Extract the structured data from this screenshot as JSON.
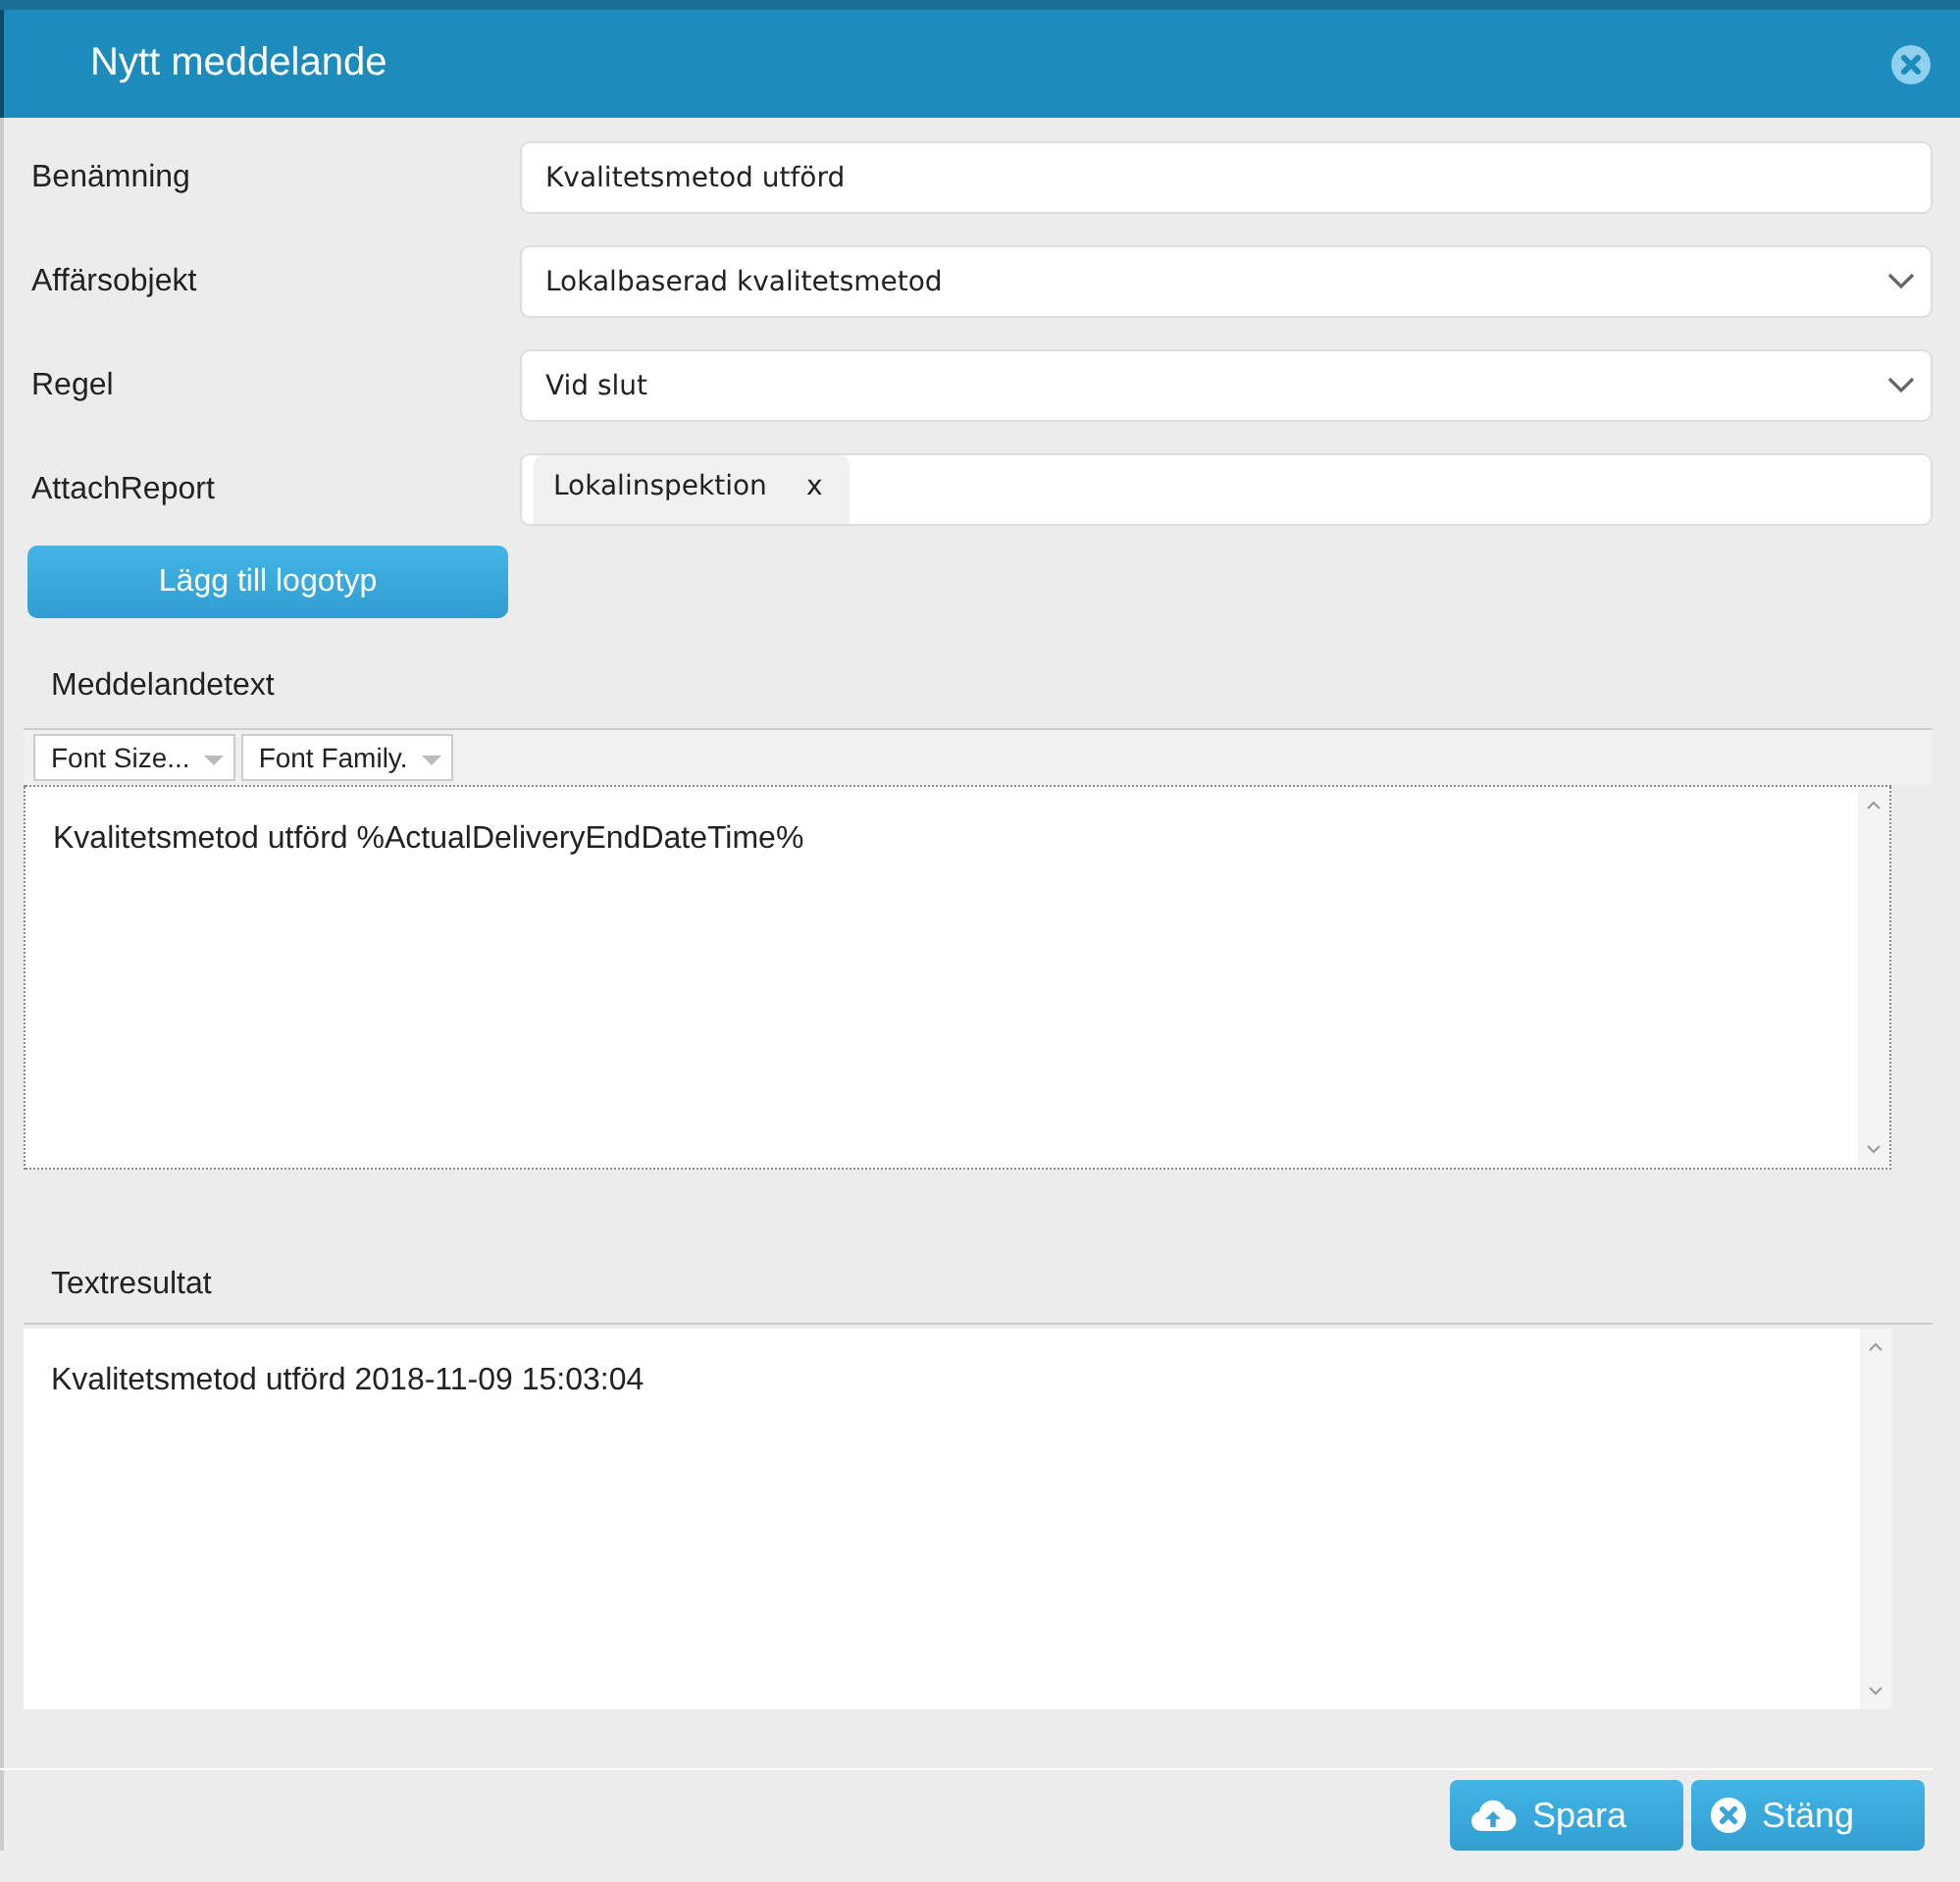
{
  "window": {
    "title": "Nytt meddelande"
  },
  "fields": [
    {
      "label": "Benämning",
      "kind": "text",
      "value": "Kvalitetsmetod utförd"
    },
    {
      "label": "Affärsobjekt",
      "kind": "select",
      "value": "Lokalbaserad kvalitetsmetod"
    },
    {
      "label": "Regel",
      "kind": "select",
      "value": "Vid slut"
    },
    {
      "label": "AttachReport",
      "kind": "tags",
      "tags": [
        {
          "label": "Lokalinspektion",
          "remove": "x"
        }
      ]
    }
  ],
  "logo_button": "Lägg till logotyp",
  "message": {
    "label": "Meddelandetext",
    "toolbar": [
      "Font Size...",
      "Font Family."
    ],
    "text": "Kvalitetsmetod utförd %ActualDeliveryEndDateTime%"
  },
  "result": {
    "label": "Textresultat",
    "text": "Kvalitetsmetod utförd 2018-11-09 15:03:04"
  },
  "buttons": [
    {
      "label": "Spara",
      "kind": "save"
    },
    {
      "label": "Stäng",
      "kind": "close"
    }
  ]
}
